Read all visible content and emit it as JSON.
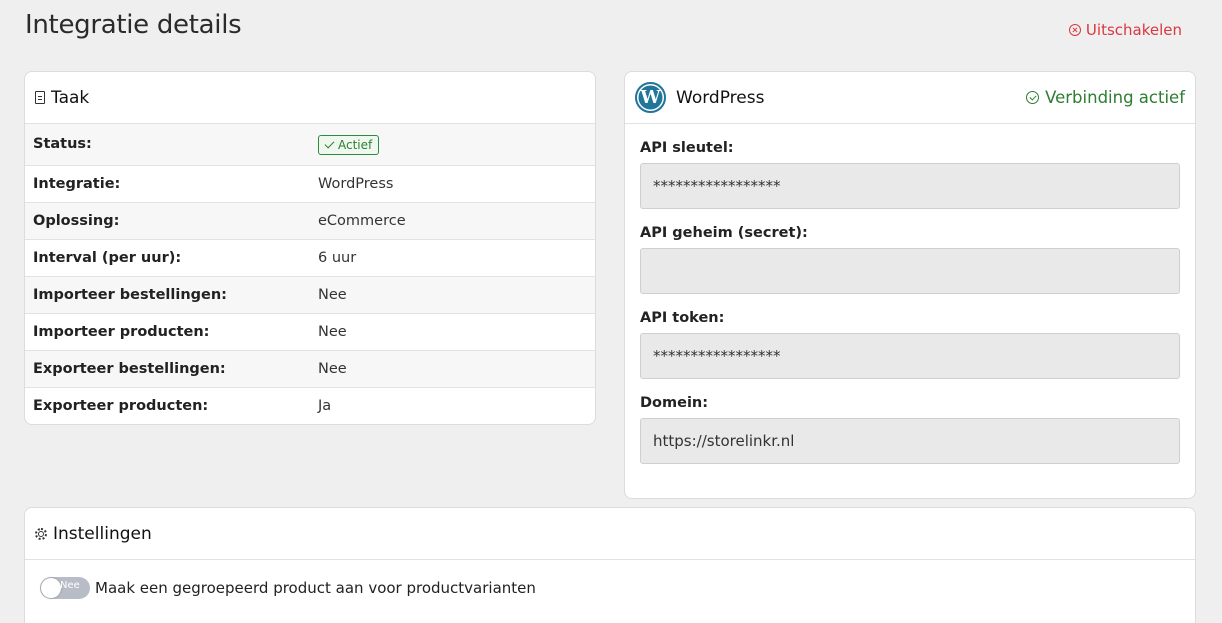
{
  "page": {
    "title": "Integratie details",
    "disable_label": "Uitschakelen"
  },
  "taak": {
    "title": "Taak",
    "rows": [
      {
        "key": "Status:",
        "value": "Actief"
      },
      {
        "key": "Integratie:",
        "value": "WordPress"
      },
      {
        "key": "Oplossing:",
        "value": "eCommerce"
      },
      {
        "key": "Interval (per uur):",
        "value": "6 uur"
      },
      {
        "key": "Importeer bestellingen:",
        "value": "Nee"
      },
      {
        "key": "Importeer producten:",
        "value": "Nee"
      },
      {
        "key": "Exporteer bestellingen:",
        "value": "Nee"
      },
      {
        "key": "Exporteer producten:",
        "value": "Ja"
      }
    ]
  },
  "wordpress": {
    "logo_letter": "W",
    "title": "WordPress",
    "connection_status": "Verbinding actief",
    "fields": [
      {
        "label": "API sleutel:",
        "value": "*****************"
      },
      {
        "label": "API geheim (secret):",
        "value": ""
      },
      {
        "label": "API token:",
        "value": "*****************"
      },
      {
        "label": "Domein:",
        "value": "https://storelinkr.nl"
      }
    ]
  },
  "settings": {
    "title": "Instellingen",
    "items": [
      {
        "toggle_text": "Nee",
        "label": "Maak een gegroepeerd product aan voor productvarianten"
      }
    ]
  },
  "colors": {
    "success": "#2e7d32",
    "danger": "#d9383e",
    "wordpress_blue": "#21759b"
  }
}
